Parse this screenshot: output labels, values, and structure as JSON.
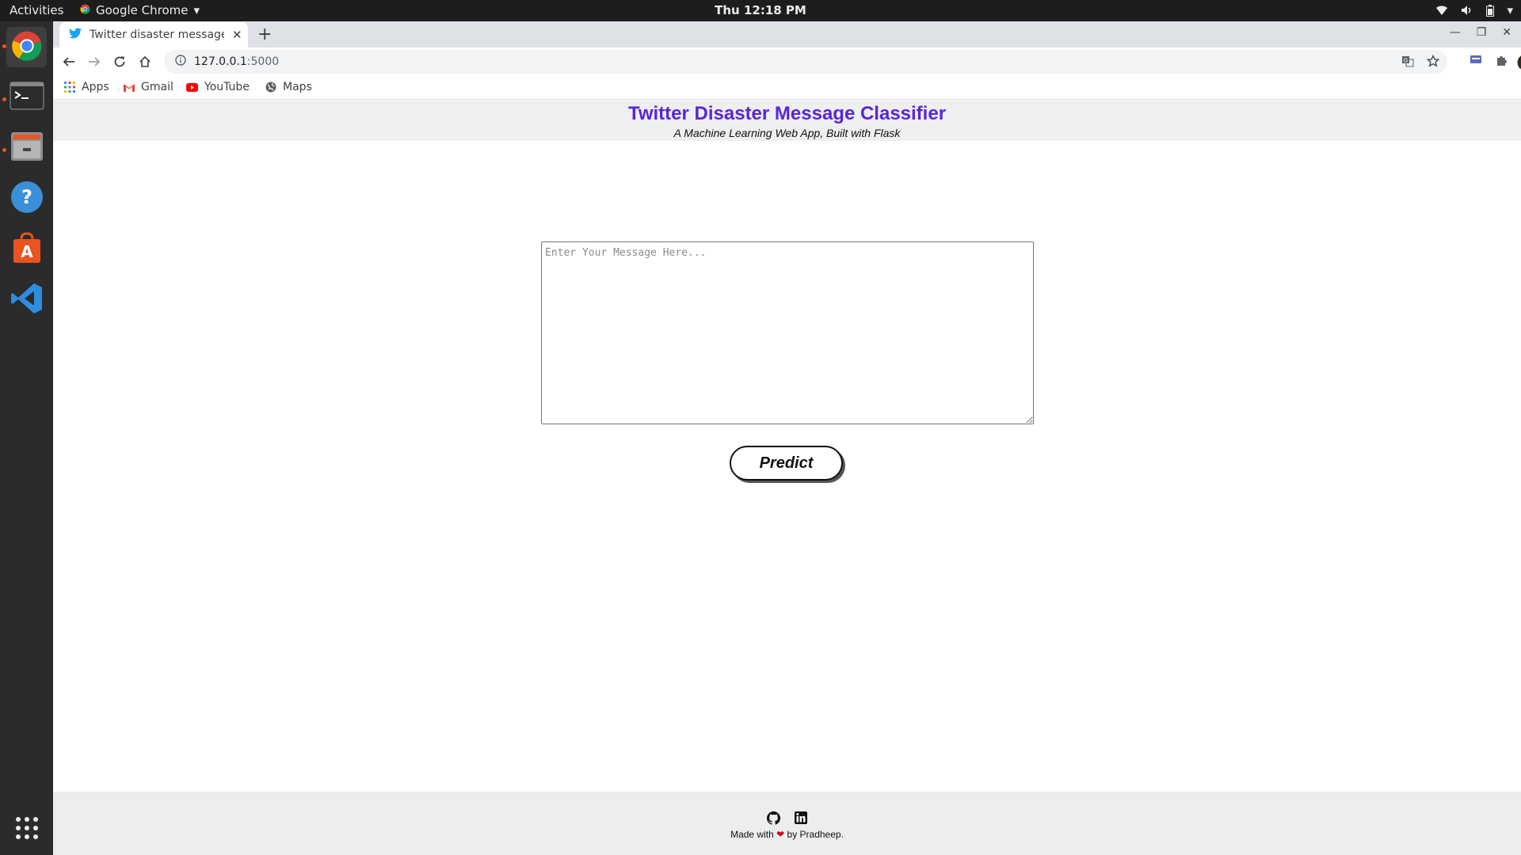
{
  "system": {
    "activities": "Activities",
    "app_menu": "Google Chrome",
    "clock": "Thu 12:18 PM"
  },
  "browser": {
    "tab_title": "Twitter disaster message classifier",
    "url_host": "127.0.0.1",
    "url_port": ":5000",
    "bookmarks": [
      "Apps",
      "Gmail",
      "YouTube",
      "Maps"
    ]
  },
  "page": {
    "title": "Twitter Disaster Message Classifier",
    "subtitle": "A Machine Learning Web App, Built with Flask",
    "message_placeholder": "Enter Your Message Here...",
    "message_value": "",
    "predict_label": "Predict",
    "footer": {
      "made_with": "Made with",
      "by": "by Pradheep."
    }
  },
  "colors": {
    "title": "#5a25d9",
    "heart": "#d0021b",
    "accent_dock": "#e95420"
  }
}
